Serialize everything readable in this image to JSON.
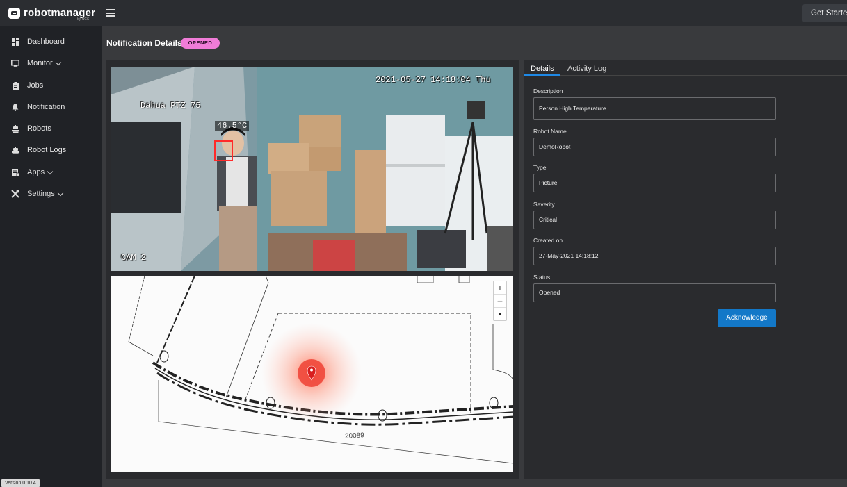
{
  "app": {
    "logo_text": "robotmanager",
    "logo_sub": "by NCS",
    "get_started": "Get Started"
  },
  "sidebar": {
    "items": [
      {
        "label": "Dashboard",
        "icon": "dashboard-icon"
      },
      {
        "label": "Monitor",
        "icon": "monitor-icon"
      },
      {
        "label": "Jobs",
        "icon": "clipboard-icon"
      },
      {
        "label": "Notification",
        "icon": "bell-icon"
      },
      {
        "label": "Robots",
        "icon": "robot-icon"
      },
      {
        "label": "Robot Logs",
        "icon": "robot-log-icon"
      },
      {
        "label": "Apps",
        "icon": "apps-icon"
      },
      {
        "label": "Settings",
        "icon": "tools-icon"
      }
    ],
    "version": "Version 0.10.4"
  },
  "page": {
    "title": "Notification Details",
    "status_badge": "OPENED"
  },
  "camera": {
    "camera_name": "Dahua PTZ 75",
    "timestamp": "2021-05-27 14:18:04 Thu",
    "temperature": "46.5°C",
    "cam_label": "CAM 2"
  },
  "map": {
    "zoom_in": "+",
    "zoom_out": "−",
    "dimension_label": "20089"
  },
  "details": {
    "tabs": [
      "Details",
      "Activity Log"
    ],
    "fields": {
      "description_label": "Description",
      "description_value": "Person High Temperature",
      "robot_name_label": "Robot Name",
      "robot_name_value": "DemoRobot",
      "type_label": "Type",
      "type_value": "Picture",
      "severity_label": "Severity",
      "severity_value": "Critical",
      "created_label": "Created on",
      "created_value": "27-May-2021 14:18:12",
      "status_label": "Status",
      "status_value": "Opened"
    },
    "acknowledge_button": "Acknowledge"
  },
  "colors": {
    "accent": "#1378c8",
    "badge": "#f07cd8",
    "marker": "#f0473a"
  }
}
